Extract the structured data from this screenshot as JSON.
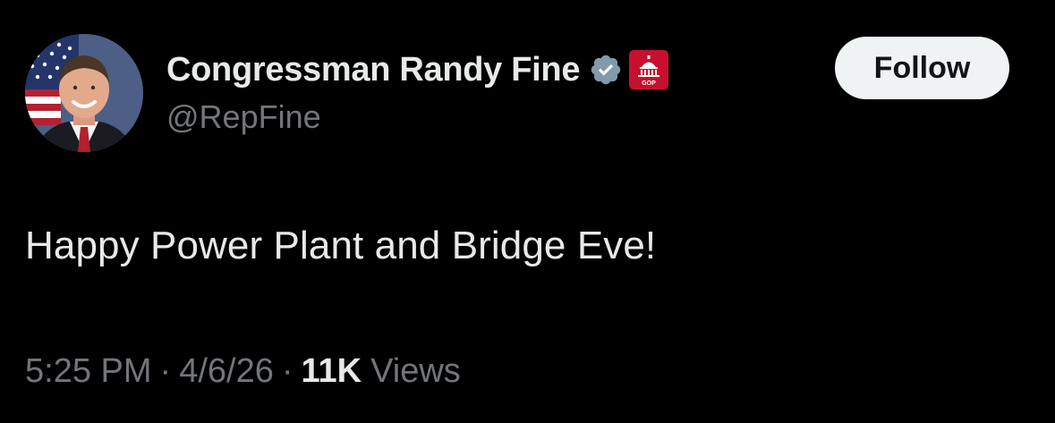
{
  "author": {
    "display_name": "Congressman Randy Fine",
    "handle": "@RepFine",
    "verified_badge_color": "#829aab",
    "affiliate_badge_color": "#c8102e",
    "affiliate_badge_text": "GOP"
  },
  "follow_button": {
    "label": "Follow"
  },
  "tweet": {
    "text": "Happy Power Plant and Bridge Eve!"
  },
  "meta": {
    "time": "5:25 PM",
    "separator": "·",
    "date": "4/6/26",
    "views_count": "11K",
    "views_label": "Views"
  },
  "colors": {
    "background": "#000000",
    "primary_text": "#e7e9ea",
    "secondary_text": "#71767b",
    "button_bg": "#eff3f4",
    "button_text": "#0f1419"
  }
}
